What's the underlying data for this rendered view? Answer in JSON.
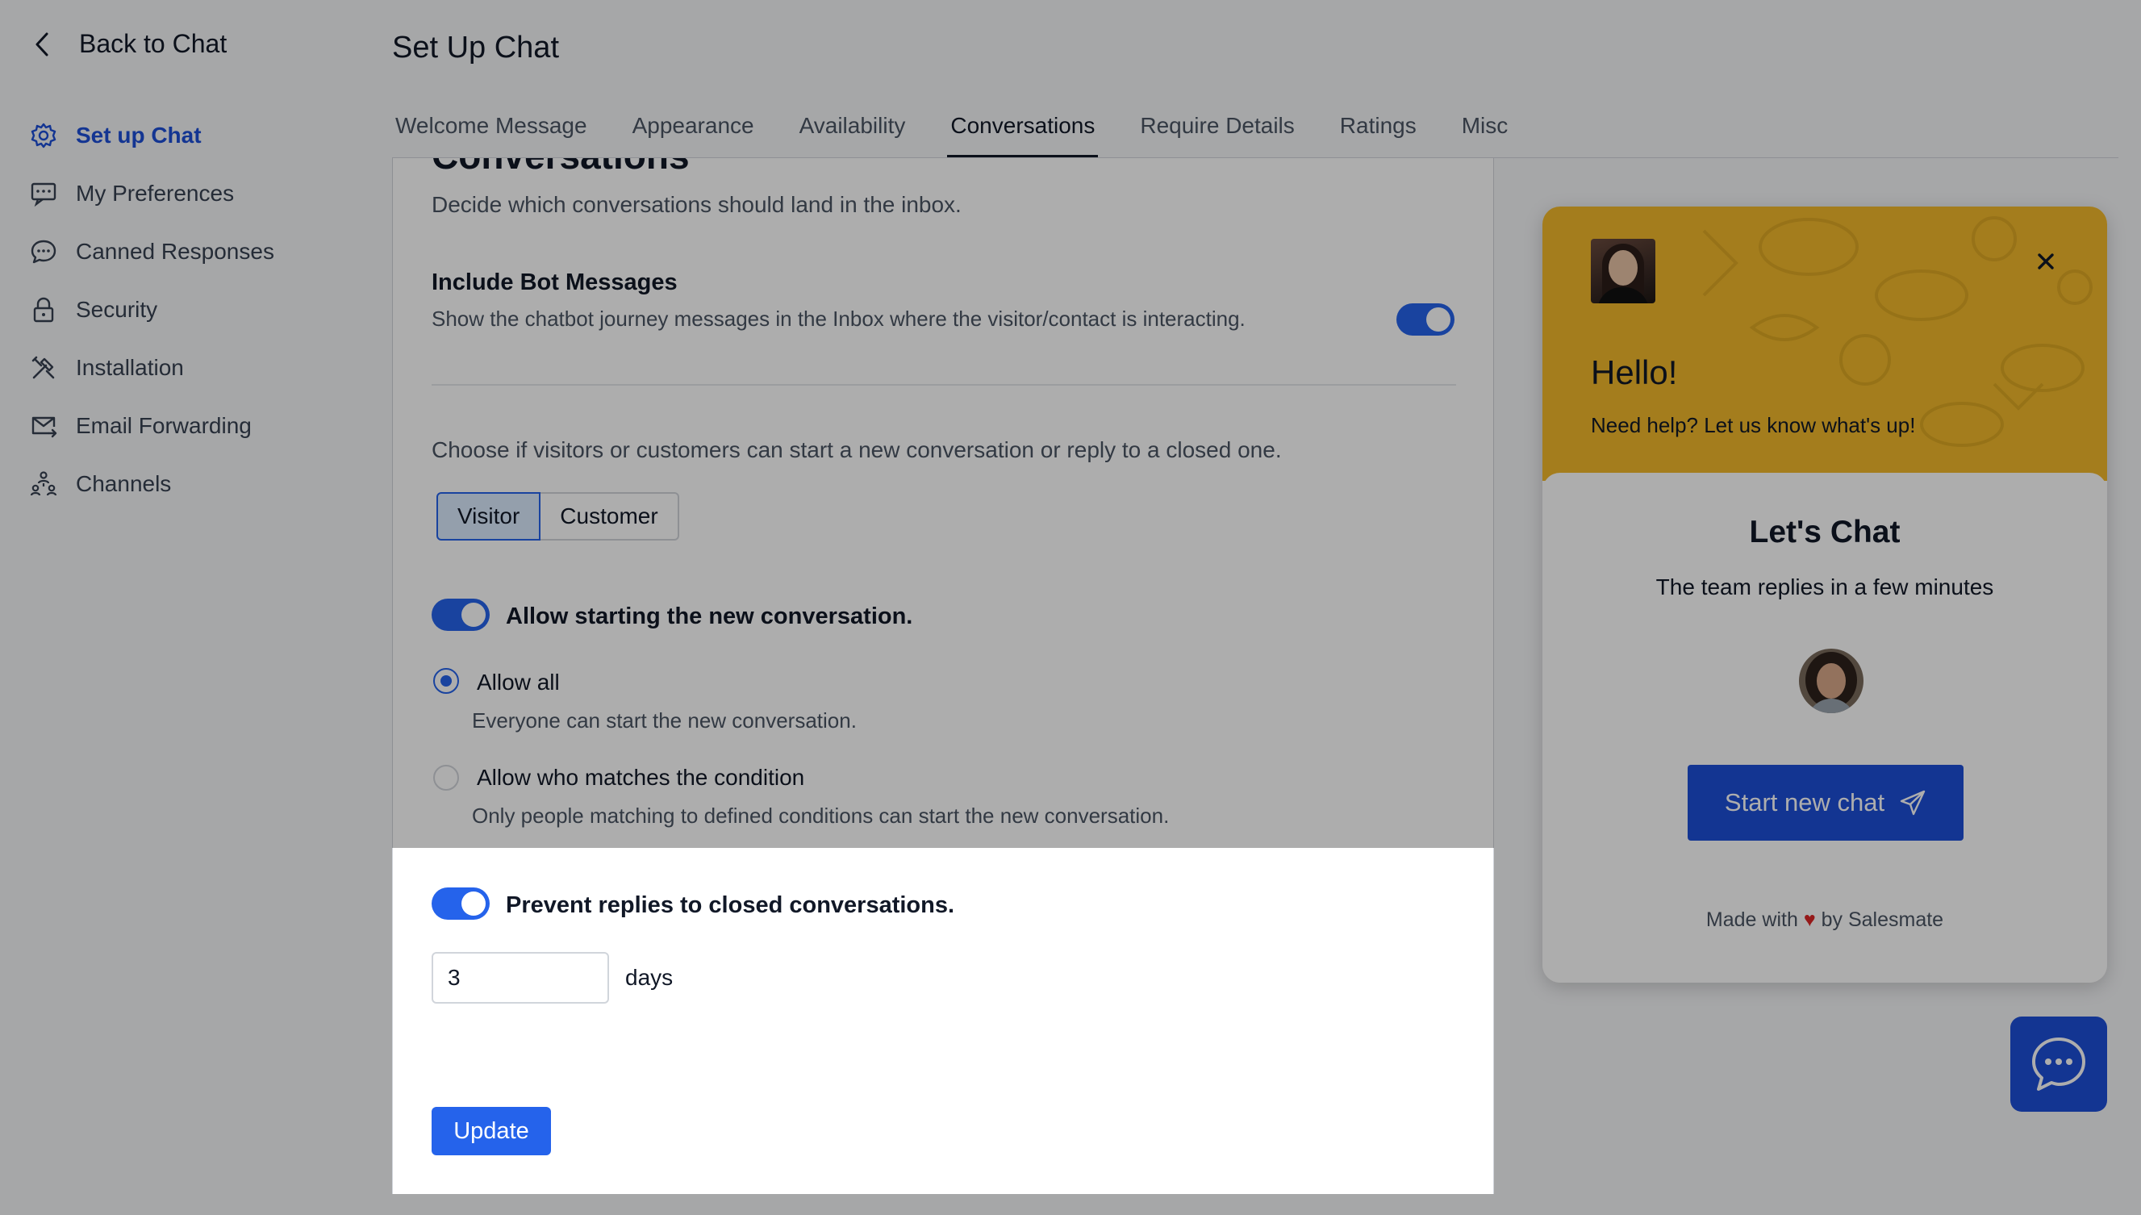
{
  "sidebar": {
    "back_label": "Back to Chat",
    "items": [
      {
        "label": "Set up Chat",
        "icon": "gear-icon",
        "active": true
      },
      {
        "label": "My Preferences",
        "icon": "preferences-icon"
      },
      {
        "label": "Canned Responses",
        "icon": "chat-bubble-icon"
      },
      {
        "label": "Security",
        "icon": "lock-icon"
      },
      {
        "label": "Installation",
        "icon": "tools-icon"
      },
      {
        "label": "Email Forwarding",
        "icon": "mail-forward-icon"
      },
      {
        "label": "Channels",
        "icon": "channels-icon"
      }
    ]
  },
  "header": {
    "title": "Set Up Chat",
    "tabs": [
      {
        "label": "Welcome Message"
      },
      {
        "label": "Appearance"
      },
      {
        "label": "Availability"
      },
      {
        "label": "Conversations",
        "active": true
      },
      {
        "label": "Require Details"
      },
      {
        "label": "Ratings"
      },
      {
        "label": "Misc"
      }
    ]
  },
  "main": {
    "section_title": "Conversations",
    "section_sub": "Decide which conversations should land in the inbox.",
    "bot": {
      "title": "Include Bot Messages",
      "desc": "Show the chatbot journey messages in the Inbox where the visitor/contact is interacting.",
      "enabled": true
    },
    "choose_text": "Choose if visitors or customers can start a new conversation or reply to a closed one.",
    "segments": [
      "Visitor",
      "Customer"
    ],
    "allow_new": {
      "title": "Allow starting the new conversation.",
      "enabled": true,
      "options": [
        {
          "label": "Allow all",
          "desc": "Everyone can start the new conversation.",
          "checked": true
        },
        {
          "label": "Allow who matches the condition",
          "desc": "Only people matching to defined conditions can start the new conversation.",
          "checked": false
        }
      ]
    },
    "prevent_replies": {
      "title": "Prevent replies to closed conversations.",
      "enabled": true,
      "days_value": "3",
      "days_label": "days"
    },
    "update_label": "Update"
  },
  "widget": {
    "hello": "Hello!",
    "need_help": "Need help? Let us know what's up!",
    "lets_chat": "Let's Chat",
    "team_replies": "The team replies in a few minutes",
    "start_chat": "Start new chat",
    "made_with_prefix": "Made with",
    "made_with_suffix": "by Salesmate",
    "header_color": "#f2b92b",
    "button_color": "#1d4ed8"
  },
  "colors": {
    "accent": "#2563eb",
    "active_nav": "#1d4ed8",
    "heart": "#dc2626"
  }
}
